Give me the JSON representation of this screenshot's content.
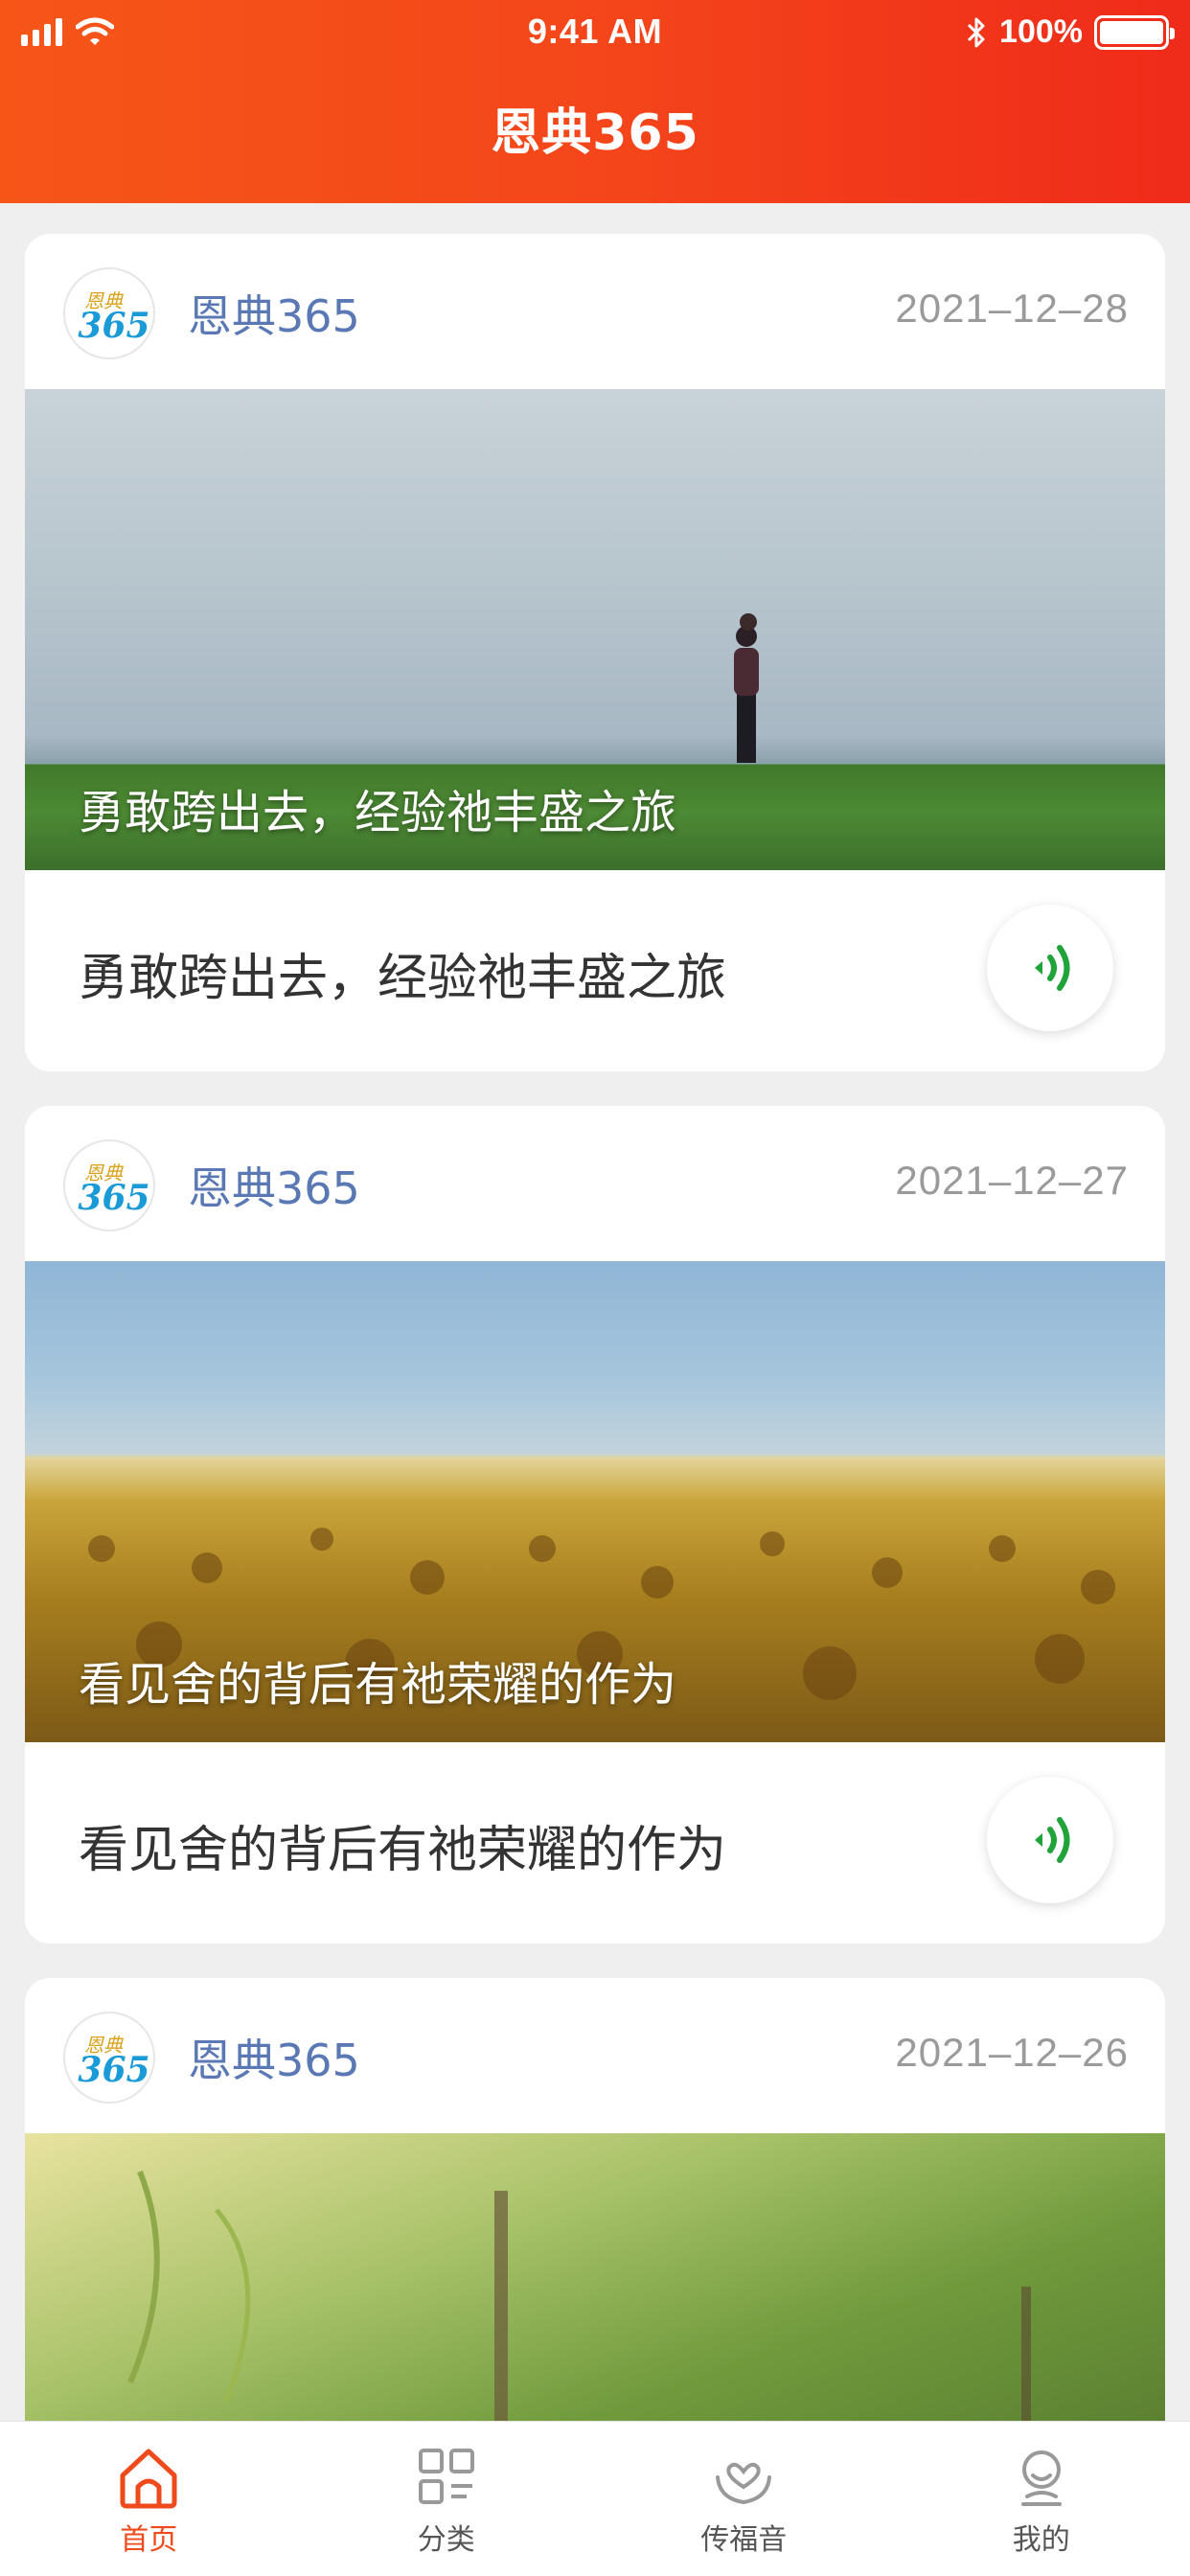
{
  "status_bar": {
    "time": "9:41 AM",
    "battery": "100%"
  },
  "header": {
    "title": "恩典365"
  },
  "feed": [
    {
      "author": "恩典365",
      "date": "2021–12–28",
      "image_caption": "勇敢跨出去，经验祂丰盛之旅",
      "title": "勇敢跨出去，经验祂丰盛之旅",
      "image": "grass-horizon"
    },
    {
      "author": "恩典365",
      "date": "2021–12–27",
      "image_caption": "看见舍的背后有祂荣耀的作为",
      "title": "看见舍的背后有祂荣耀的作为",
      "image": "sunflower-field"
    },
    {
      "author": "恩典365",
      "date": "2021–12–26",
      "image_caption": "",
      "title": "",
      "image": "green-field"
    }
  ],
  "avatar_logo": {
    "line1": "恩典",
    "line2": "365"
  },
  "tabs": [
    {
      "label": "首页",
      "icon": "home-icon",
      "active": true
    },
    {
      "label": "分类",
      "icon": "grid-icon",
      "active": false
    },
    {
      "label": "传福音",
      "icon": "hands-heart-icon",
      "active": false
    },
    {
      "label": "我的",
      "icon": "profile-icon",
      "active": false
    }
  ],
  "colors": {
    "accent": "#ee4a1c",
    "author": "#5a78b4",
    "audio": "#1fa33a"
  }
}
